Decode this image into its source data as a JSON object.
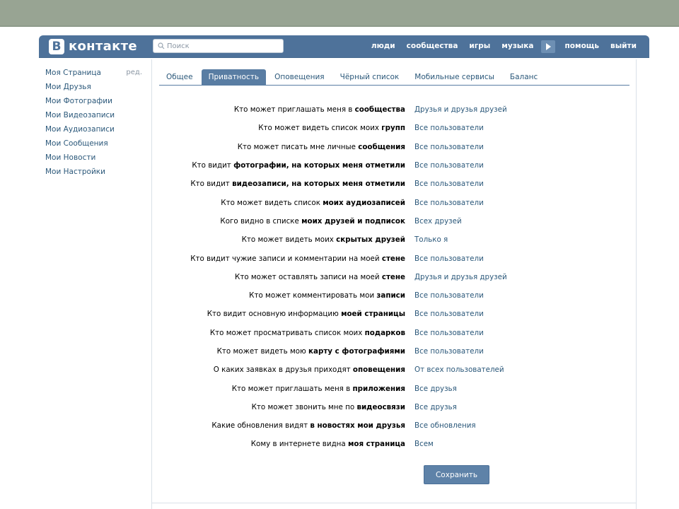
{
  "header": {
    "logo_letter": "В",
    "logo_text": "контакте",
    "search_placeholder": "Поиск",
    "nav": [
      "люди",
      "сообщества",
      "игры",
      "музыка",
      "помощь",
      "выйти"
    ],
    "brand_color": "#4e729a"
  },
  "sidebar": {
    "edit_label": "ред.",
    "items": [
      "Моя Страница",
      "Мои Друзья",
      "Мои Фотографии",
      "Мои Видеозаписи",
      "Мои Аудиозаписи",
      "Мои Сообщения",
      "Мои Новости",
      "Мои Настройки"
    ]
  },
  "tabs": [
    {
      "label": "Общее",
      "active": false
    },
    {
      "label": "Приватность",
      "active": true
    },
    {
      "label": "Оповещения",
      "active": false
    },
    {
      "label": "Чёрный список",
      "active": false
    },
    {
      "label": "Мобильные сервисы",
      "active": false
    },
    {
      "label": "Баланс",
      "active": false
    }
  ],
  "privacy": [
    {
      "pre": "Кто может приглашать меня в ",
      "bold": "сообщества",
      "post": "",
      "value": "Друзья и друзья друзей"
    },
    {
      "pre": "Кто может видеть список моих ",
      "bold": "групп",
      "post": "",
      "value": "Все пользователи"
    },
    {
      "pre": "Кто может писать мне личные ",
      "bold": "сообщения",
      "post": "",
      "value": "Все пользователи"
    },
    {
      "pre": "Кто видит ",
      "bold": "фотографии, на которых меня отметили",
      "post": "",
      "value": "Все пользователи"
    },
    {
      "pre": "Кто видит ",
      "bold": "видеозаписи, на которых меня отметили",
      "post": "",
      "value": "Все пользователи"
    },
    {
      "pre": "Кто может видеть список ",
      "bold": "моих аудиозаписей",
      "post": "",
      "value": "Все пользователи"
    },
    {
      "pre": "Кого видно в списке ",
      "bold": "моих друзей и подписок",
      "post": "",
      "value": "Всех друзей"
    },
    {
      "pre": "Кто может видеть моих ",
      "bold": "скрытых друзей",
      "post": "",
      "value": "Только я"
    },
    {
      "pre": "Кто видит чужие записи и комментарии на моей ",
      "bold": "стене",
      "post": "",
      "value": "Все пользователи"
    },
    {
      "pre": "Кто может оставлять записи на моей ",
      "bold": "стене",
      "post": "",
      "value": "Друзья и друзья друзей"
    },
    {
      "pre": "Кто может комментировать мои ",
      "bold": "записи",
      "post": "",
      "value": "Все пользователи"
    },
    {
      "pre": "Кто видит основную информацию ",
      "bold": "моей страницы",
      "post": "",
      "value": "Все пользователи"
    },
    {
      "pre": "Кто может просматривать список моих ",
      "bold": "подарков",
      "post": "",
      "value": "Все пользователи"
    },
    {
      "pre": "Кто может видеть мою ",
      "bold": "карту с фотографиями",
      "post": "",
      "value": "Все пользователи"
    },
    {
      "pre": "О каких заявках в друзья приходят ",
      "bold": "оповещения",
      "post": "",
      "value": "От всех пользователей"
    },
    {
      "pre": "Кто может приглашать меня в ",
      "bold": "приложения",
      "post": "",
      "value": "Все друзья"
    },
    {
      "pre": "Кто может звонить мне по ",
      "bold": "видеосвязи",
      "post": "",
      "value": "Все друзья"
    },
    {
      "pre": "Какие обновления видят ",
      "bold": "в новостях мои друзья",
      "post": "",
      "value": "Все обновления"
    },
    {
      "pre": "Кому в интернете видна ",
      "bold": "моя страница",
      "post": "",
      "value": "Всем"
    }
  ],
  "save_label": "Сохранить"
}
